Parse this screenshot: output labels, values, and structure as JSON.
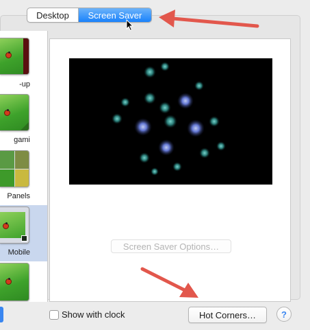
{
  "tabs": {
    "desktop": "Desktop",
    "screen_saver": "Screen Saver",
    "selected": "Screen Saver"
  },
  "saver_list": {
    "items": [
      {
        "label": "-up",
        "icon": "ladybug-photo-thumbnail"
      },
      {
        "label": "gami",
        "icon": "origami-thumbnail"
      },
      {
        "label": "Panels",
        "icon": "sliding-panels-thumbnail"
      },
      {
        "label": "Mobile",
        "icon": "mobile-thumbnail",
        "selected": true
      },
      {
        "label": "",
        "icon": "photo-thumbnail"
      }
    ]
  },
  "preview": {
    "options_label": "Screen Saver Options…"
  },
  "bottom": {
    "show_with_clock_label": "Show with clock",
    "show_with_clock_checked": false,
    "hot_corners_label": "Hot Corners…",
    "help_label": "?"
  },
  "colors": {
    "accent_blue": "#1a82fb",
    "annotation_arrow": "#e2574c",
    "window_bg": "#ececec"
  }
}
